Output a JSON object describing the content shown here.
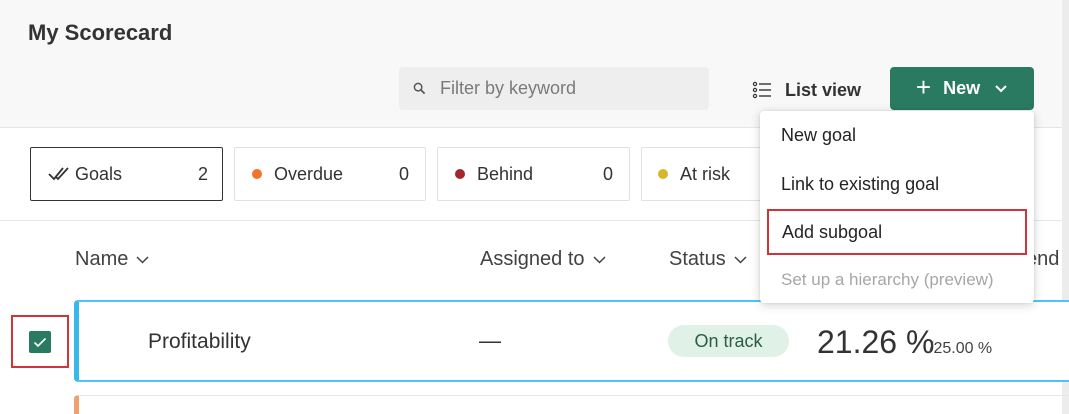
{
  "header": {
    "title": "My Scorecard",
    "search_placeholder": "Filter by keyword",
    "list_view_label": "List view",
    "new_button_label": "New"
  },
  "filters": [
    {
      "label": "Goals",
      "count": "2",
      "icon": "double-check-icon"
    },
    {
      "label": "Overdue",
      "count": "0",
      "color": "#f2742b"
    },
    {
      "label": "Behind",
      "count": "0",
      "color": "#a4262c"
    },
    {
      "label": "At risk",
      "count": "",
      "color": "#d8b62a"
    }
  ],
  "columns": {
    "name": "Name",
    "assigned": "Assigned to",
    "status": "Status",
    "trend_partial": "end"
  },
  "rows": [
    {
      "name": "Profitability",
      "assigned": "—",
      "status": "On track",
      "value": "21.26 %",
      "target": "/25.00 %",
      "checked": true
    }
  ],
  "new_menu": {
    "items": [
      {
        "label": "New goal",
        "enabled": true
      },
      {
        "label": "Link to existing goal",
        "enabled": true
      },
      {
        "label": "Add subgoal",
        "enabled": true,
        "highlighted": true
      },
      {
        "label": "Set up a hierarchy (preview)",
        "enabled": false
      }
    ]
  },
  "colors": {
    "accent": "#2a7a62",
    "highlight_border": "#d13438",
    "row_accent": "#36b8e8",
    "on_track_bg": "#e0f1e7"
  }
}
